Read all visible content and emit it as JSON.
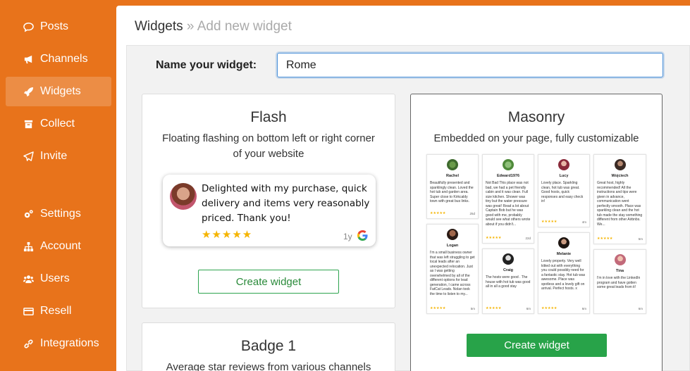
{
  "sidebar": {
    "items": [
      {
        "label": "Posts",
        "icon": "chat-bubble-icon"
      },
      {
        "label": "Channels",
        "icon": "megaphone-icon"
      },
      {
        "label": "Widgets",
        "icon": "rocket-icon",
        "active": true
      },
      {
        "label": "Collect",
        "icon": "inbox-icon"
      },
      {
        "label": "Invite",
        "icon": "paper-plane-icon"
      },
      {
        "label": "Settings",
        "icon": "gears-icon"
      },
      {
        "label": "Account",
        "icon": "sitemap-icon"
      },
      {
        "label": "Users",
        "icon": "users-icon"
      },
      {
        "label": "Resell",
        "icon": "credit-card-icon"
      },
      {
        "label": "Integrations",
        "icon": "link-icon"
      }
    ]
  },
  "header": {
    "title": "Widgets",
    "separator": "»",
    "subtitle": "Add new widget"
  },
  "form": {
    "name_label": "Name your widget:",
    "name_value": "Rome"
  },
  "cards": {
    "flash": {
      "title": "Flash",
      "description": "Floating flashing on bottom left or right corner of your website",
      "preview": {
        "review_text": "Delighted with my purchase, quick delivery and items very reasonably priced. Thank you!",
        "stars": "★★★★★",
        "age": "1y"
      },
      "button_label": "Create widget"
    },
    "masonry": {
      "title": "Masonry",
      "description": "Embedded on your page, fully customizable",
      "button_label": "Create widget",
      "tiles": [
        {
          "name": "Rachel",
          "text": "Beautifully presented and sparklingly clean. Loved the hot tub and garden area. Super close to Kirkcaldy town with great bus links.",
          "stars": "★★★★★",
          "time": "25d"
        },
        {
          "name": "Edward1976",
          "text": "Not Bad This place was not bad, we had a pet friendly cabin and it was clean. Full size kitchen. Shower was tiny but the water pressure was great! Read a lot about Captain Bob but he was good with me, probably would see what others wrote about if you didn't...",
          "more": "Read more",
          "stars": "★★★★★",
          "time": "22d"
        },
        {
          "name": "Lucy",
          "text": "Lovely place. Sparkling clean, hot tub was great. Good hosts, quick responses and easy check in!",
          "stars": "★★★★★",
          "time": "4m"
        },
        {
          "name": "Wojciech",
          "text": "Great host, highly recommended! All the instructions and tips were given in advance, communication went perfectly smooth. Place was sparkling clean and the hot tub made the stay something different from other Airbnbs. We...",
          "more": "Read more",
          "stars": "★★★★★",
          "time": "5m"
        },
        {
          "name": "Logan",
          "text": "I'm a small business owner that was left struggling to get local leads after an unexpected relocation. Just as I was getting overwhelmed by all of the different options for lead generation, I came across FatCat Leads. Nolan took the time to listen to my...",
          "more": "Read more",
          "stars": "★★★★★",
          "time": "5m"
        },
        {
          "name": "Craig",
          "text": "The hosts were good . The house with hot tub was good all in all a good stay",
          "stars": "★★★★★",
          "time": "6m"
        },
        {
          "name": "Melanie",
          "text": "Lovely property. Very well kitted out with everything you could possibly need for a fantastic stay. Hot tub was awesome. Place was spotless and a lovely gift on arrival. Perfect hosts. x",
          "stars": "★★★★★",
          "time": "6m"
        },
        {
          "name": "Tina",
          "text": "I'm in love with the LinkedIn program and have gotten some great leads from it!",
          "stars": "",
          "time": "6m"
        }
      ]
    },
    "badge": {
      "title": "Badge 1",
      "description": "Average star reviews from various channels"
    }
  },
  "colors": {
    "sidebar_bg": "#e8731b",
    "sidebar_active": "#ec8d45",
    "accent_green": "#28a349",
    "input_focus": "#4a90d9",
    "star": "#f5b400"
  }
}
